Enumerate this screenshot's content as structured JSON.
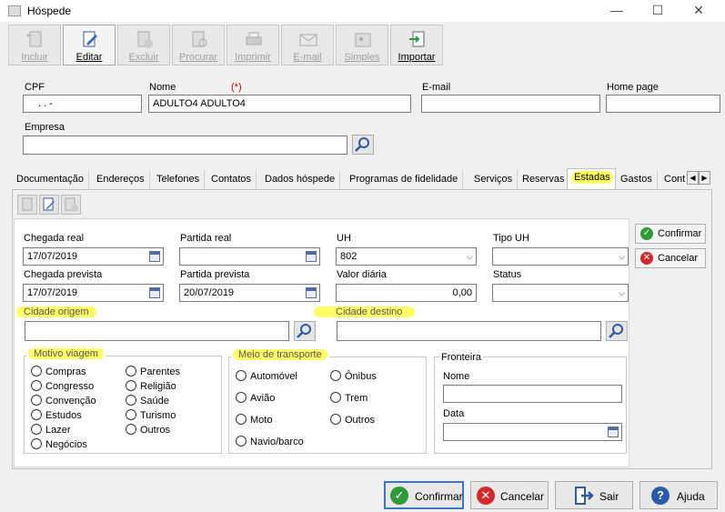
{
  "window": {
    "title": "Hóspede",
    "minimize": "—",
    "maximize": "☐",
    "close": "✕"
  },
  "toolbar": [
    {
      "label": "Incluir",
      "icon": "add-document-icon",
      "enabled": false
    },
    {
      "label": "Editar",
      "icon": "edit-document-icon",
      "enabled": true
    },
    {
      "label": "Excluir",
      "icon": "delete-document-icon",
      "enabled": false
    },
    {
      "label": "Procurar",
      "icon": "search-document-icon",
      "enabled": false
    },
    {
      "label": "Imprimir",
      "icon": "printer-icon",
      "enabled": false
    },
    {
      "label": "E-mail",
      "icon": "email-icon",
      "enabled": false
    },
    {
      "label": "Simples",
      "icon": "simple-card-icon",
      "enabled": false
    },
    {
      "label": "Importar",
      "icon": "import-icon",
      "enabled": true
    }
  ],
  "form": {
    "cpf_label": "CPF",
    "cpf_value": ". . -",
    "nome_label": "Nome",
    "nome_required": "(*)",
    "nome_value": "ADULTO4 ADULTO4",
    "email_label": "E-mail",
    "email_value": "",
    "homepage_label": "Home page",
    "homepage_value": "",
    "empresa_label": "Empresa",
    "empresa_value": ""
  },
  "tabs": [
    "Documentação",
    "Endereços",
    "Telefones",
    "Contatos",
    "Dados hóspede",
    "Programas de fidelidade",
    "Serviços",
    "Reservas",
    "Estadas",
    "Gastos",
    "Cont"
  ],
  "selected_tab": "Estadas",
  "estadas": {
    "chegada_real_label": "Chegada real",
    "chegada_real_value": "17/07/2019",
    "partida_real_label": "Partida real",
    "partida_real_value": "",
    "uh_label": "UH",
    "uh_value": "802",
    "tipo_uh_label": "Tipo UH",
    "tipo_uh_value": "",
    "chegada_prevista_label": "Chegada prevista",
    "chegada_prevista_value": "17/07/2019",
    "partida_prevista_label": "Partida prevista",
    "partida_prevista_value": "20/07/2019",
    "valor_diaria_label": "Valor diária",
    "valor_diaria_value": "0,00",
    "status_label": "Status",
    "status_value": "",
    "cidade_origem_label": "Cidade origem",
    "cidade_origem_value": "",
    "cidade_destino_label": "Cidade destino",
    "cidade_destino_value": "",
    "motivo_label": "Motivo viagem",
    "motivo_col1": [
      "Compras",
      "Congresso",
      "Convenção",
      "Estudos",
      "Lazer",
      "Negócios"
    ],
    "motivo_col2": [
      "Parentes",
      "Religião",
      "Saúde",
      "Turismo",
      "Outros"
    ],
    "transporte_label": "Meio de transporte",
    "transporte_col1": [
      "Automóvel",
      "Avião",
      "Moto",
      "Navio/barco"
    ],
    "transporte_col2": [
      "Ônibus",
      "Trem",
      "Outros"
    ],
    "fronteira_label": "Fronteira",
    "fronteira_nome_label": "Nome",
    "fronteira_nome_value": "",
    "fronteira_data_label": "Data",
    "fronteira_data_value": ""
  },
  "side_buttons": {
    "confirmar": "Confirmar",
    "cancelar": "Cancelar"
  },
  "footer": {
    "confirmar": "Confirmar",
    "cancelar": "Cancelar",
    "sair": "Sair",
    "ajuda": "Ajuda"
  },
  "colors": {
    "highlight": "#ffff66",
    "confirm": "#2e9a3a",
    "cancel": "#d22a2a",
    "focus": "#3a76c8"
  }
}
